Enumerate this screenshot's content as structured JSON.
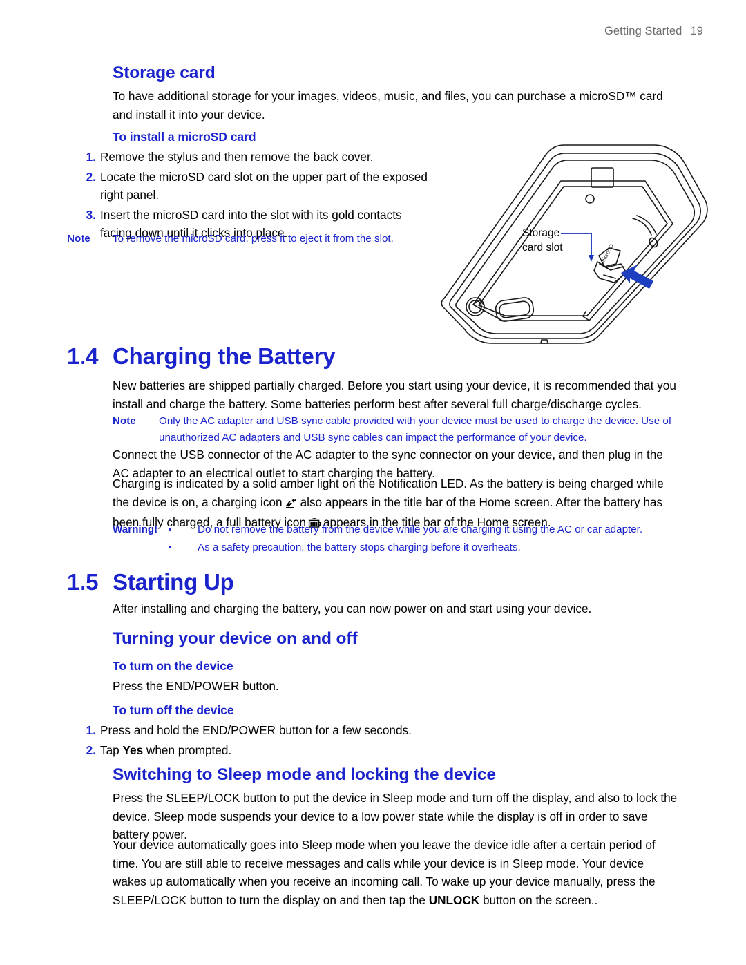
{
  "header": {
    "section": "Getting Started",
    "page_number": "19"
  },
  "colors": {
    "heading_blue": "#1a23cc",
    "body_black": "#000000",
    "header_gray": "#6d6d6d"
  },
  "storage_card": {
    "heading": "Storage card",
    "intro": "To have additional storage for your images, videos, music, and files, you can purchase a microSD™ card and install it into your device.",
    "sub_heading": "To install a microSD card",
    "steps": [
      {
        "marker": "1.",
        "text": "Remove the stylus and then remove the back cover."
      },
      {
        "marker": "2.",
        "text": "Locate the microSD card slot on the upper part of the exposed right panel."
      },
      {
        "marker": "3.",
        "text": "Insert the microSD card into the slot with its gold contacts facing down until it clicks into place."
      }
    ],
    "note": {
      "label": "Note",
      "text": "To remove the microSD card, press it to eject it from the slot."
    }
  },
  "illustration": {
    "alt": "device-back-cover-removed-diagram",
    "callout_line1": "Storage",
    "callout_line2": "card slot",
    "card_label": "microSD"
  },
  "charging": {
    "section_number": "1.4",
    "section_title": "Charging the Battery",
    "paragraph1": "New batteries are shipped partially charged. Before you start using your device, it is recommended that you install and charge the battery. Some batteries perform best after several full charge/discharge cycles.",
    "note": {
      "label": "Note",
      "text": "Only the AC adapter and USB sync cable provided with your device must be used to charge the device. Use of unauthorized AC adapters and USB sync cables can impact the performance of your device."
    },
    "paragraph2": "Connect the USB connector of the AC adapter to the sync connector on your device, and then plug in the AC adapter to an electrical outlet to start charging the battery.",
    "paragraph3_part1": "Charging is indicated by a solid amber light on the Notification LED. As the battery is being charged while the device is on, a charging icon",
    "paragraph3_part2": "also appears in the title bar of the Home screen. After the battery has been fully charged, a full battery icon",
    "paragraph3_part3": "appears in the title bar of the Home screen.",
    "icons": {
      "charging": "battery-charging-icon",
      "full_battery": "battery-full-icon"
    },
    "warning": {
      "label": "Warning!",
      "bullet": "•",
      "items": [
        "Do not remove the battery from the device while you are charging it using the AC or car adapter.",
        "As a safety precaution, the battery stops charging before it overheats."
      ]
    }
  },
  "starting_up": {
    "section_number": "1.5",
    "section_title": "Starting Up",
    "intro": "After installing and charging the battery, you can now power on and start using your device.",
    "turning_heading": "Turning your device on and off",
    "turn_on": {
      "heading": "To turn on the device",
      "text": "Press the END/POWER button."
    },
    "turn_off": {
      "heading": "To turn off the device",
      "steps": [
        {
          "marker": "1.",
          "text": "Press and hold the END/POWER button for a few seconds."
        },
        {
          "marker": "2.",
          "prefix": "Tap ",
          "bold": "Yes",
          "suffix": " when prompted."
        }
      ]
    },
    "sleep": {
      "heading": "Switching to Sleep mode and locking the device",
      "paragraph1": "Press the SLEEP/LOCK button to put the device in Sleep mode and turn off the display, and also to lock the device. Sleep mode suspends your device to a low power state while the display is off in order to save battery power.",
      "paragraph2_part1": "Your device automatically goes into Sleep mode when you leave the device idle after a certain period of time. You are still able to receive messages and calls while your device is in Sleep mode. Your device wakes up automatically when you receive an incoming call. To wake up your device manually, press the SLEEP/LOCK button to turn the display on and then tap the ",
      "paragraph2_bold": "UNLOCK",
      "paragraph2_part2": " button on the screen.."
    }
  }
}
